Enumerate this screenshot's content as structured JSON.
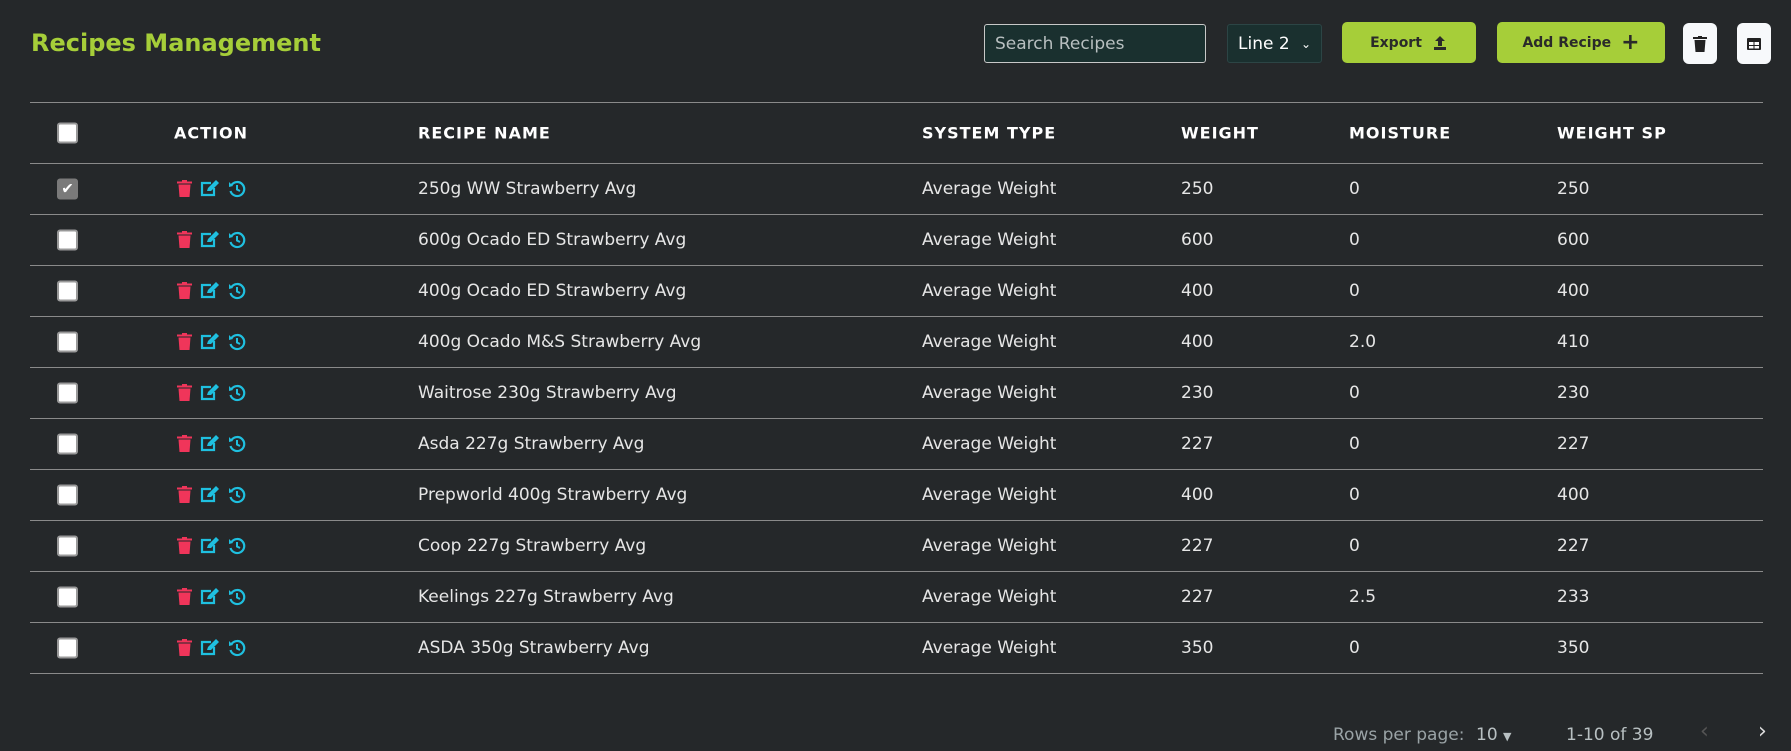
{
  "header": {
    "title": "Recipes Management",
    "search_placeholder": "Search Recipes",
    "line_select": "Line 2",
    "export_label": "Export",
    "add_label": "Add Recipe"
  },
  "columns": [
    "ACTION",
    "RECIPE NAME",
    "SYSTEM TYPE",
    "WEIGHT",
    "MOISTURE",
    "WEIGHT SP"
  ],
  "rows": [
    {
      "checked": true,
      "name": "250g WW Strawberry Avg",
      "type": "Average Weight",
      "weight": "250",
      "moisture": "0",
      "sp": "250"
    },
    {
      "checked": false,
      "name": "600g Ocado ED Strawberry Avg",
      "type": "Average Weight",
      "weight": "600",
      "moisture": "0",
      "sp": "600"
    },
    {
      "checked": false,
      "name": "400g Ocado ED Strawberry Avg",
      "type": "Average Weight",
      "weight": "400",
      "moisture": "0",
      "sp": "400"
    },
    {
      "checked": false,
      "name": "400g Ocado M&S Strawberry Avg",
      "type": "Average Weight",
      "weight": "400",
      "moisture": "2.0",
      "sp": "410"
    },
    {
      "checked": false,
      "name": "Waitrose 230g Strawberry Avg",
      "type": "Average Weight",
      "weight": "230",
      "moisture": "0",
      "sp": "230"
    },
    {
      "checked": false,
      "name": "Asda 227g Strawberry Avg",
      "type": "Average Weight",
      "weight": "227",
      "moisture": "0",
      "sp": "227"
    },
    {
      "checked": false,
      "name": "Prepworld 400g Strawberry Avg",
      "type": "Average Weight",
      "weight": "400",
      "moisture": "0",
      "sp": "400"
    },
    {
      "checked": false,
      "name": "Coop 227g Strawberry Avg",
      "type": "Average Weight",
      "weight": "227",
      "moisture": "0",
      "sp": "227"
    },
    {
      "checked": false,
      "name": "Keelings 227g Strawberry Avg",
      "type": "Average Weight",
      "weight": "227",
      "moisture": "2.5",
      "sp": "233"
    },
    {
      "checked": false,
      "name": "ASDA 350g Strawberry Avg",
      "type": "Average Weight",
      "weight": "350",
      "moisture": "0",
      "sp": "350"
    }
  ],
  "pagination": {
    "rows_per_page_label": "Rows per page:",
    "rows_per_page": "10",
    "range": "1-10 of 39"
  },
  "colors": {
    "accent": "#a6ce39",
    "delete": "#f0355a",
    "action": "#1fc0e0"
  }
}
